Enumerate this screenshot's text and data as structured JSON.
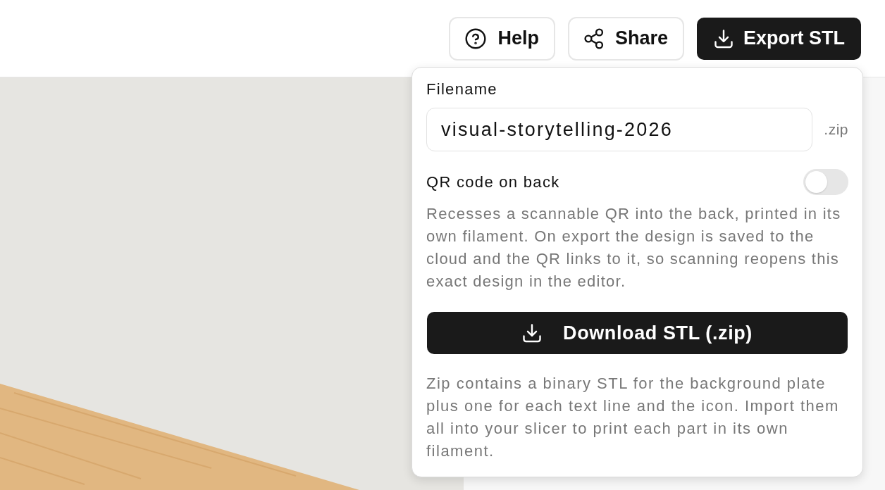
{
  "header": {
    "buttons": [
      {
        "label": "Help",
        "kind": "help"
      },
      {
        "label": "Share",
        "kind": "share"
      },
      {
        "label": "Export STL",
        "kind": "export"
      }
    ]
  },
  "export_panel": {
    "filename": {
      "label": "Filename",
      "value": "visual-storytelling-2026",
      "suffix": ".zip"
    },
    "qr_code": {
      "label": "QR code on back",
      "on": false,
      "description": "Recesses a scannable QR into the back, printed in its own filament. On export the design is saved to the cloud and the QR links to it, so scanning reopens this exact design in the editor."
    },
    "download_button": {
      "label": "Download STL (.zip)"
    },
    "note": "Zip contains a binary STL for the background plate plus one for each text line and the icon. Import them all into your slicer to print each part in its own filament."
  }
}
